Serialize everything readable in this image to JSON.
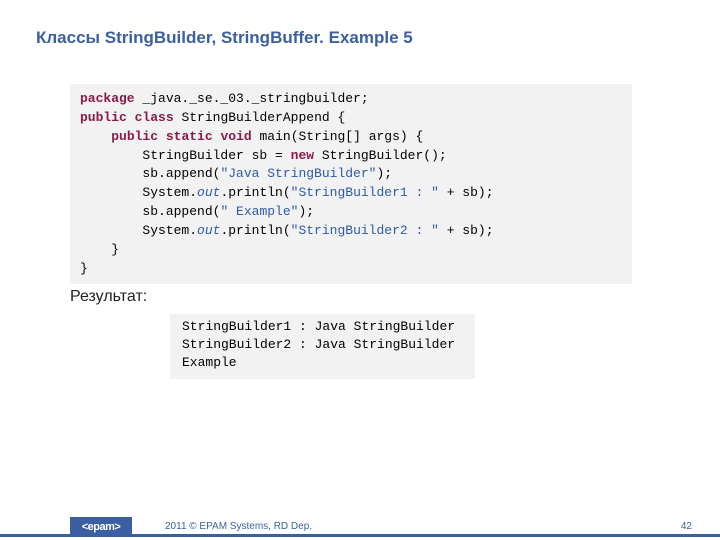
{
  "title": "Классы StringBuilder, StringBuffer. Example 5",
  "code": {
    "line1_kw": "package",
    "line1_rest": " _java._se._03._stringbuilder;",
    "line2_kw1": "public",
    "line2_kw2": "class",
    "line2_rest": " StringBuilderAppend {",
    "line3_kw1": "public",
    "line3_kw2": "static",
    "line3_kw3": "void",
    "line3_rest": " main(String[] args) {",
    "line4_a": "        StringBuilder sb = ",
    "line4_kw": "new",
    "line4_b": " StringBuilder();",
    "line5_a": "        sb.append(",
    "line5_str": "\"Java StringBuilder\"",
    "line5_b": ");",
    "line6_a": "        System.",
    "line6_f": "out",
    "line6_b": ".println(",
    "line6_str": "\"StringBuilder1 : \"",
    "line6_c": " + sb);",
    "line7_a": "        sb.append(",
    "line7_str": "\" Example\"",
    "line7_b": ");",
    "line8_a": "        System.",
    "line8_f": "out",
    "line8_b": ".println(",
    "line8_str": "\"StringBuilder2 : \"",
    "line8_c": " + sb);",
    "line9": "    }",
    "line10": "}"
  },
  "result_label": "Результат:",
  "output": "StringBuilder1 : Java StringBuilder\nStringBuilder2 : Java StringBuilder \nExample",
  "footer": {
    "logo": "<epam>",
    "copy": "2011 © EPAM Systems, RD Dep.",
    "page": "42"
  }
}
